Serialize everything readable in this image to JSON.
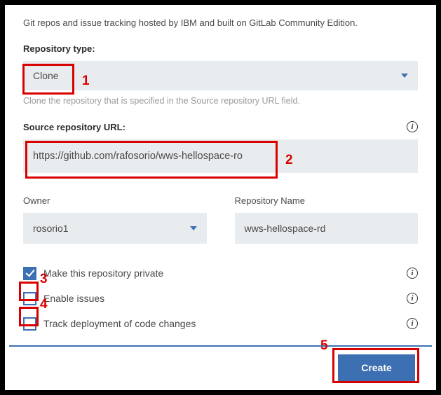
{
  "description": "Git repos and issue tracking hosted by IBM and built on GitLab Community Edition.",
  "repoType": {
    "label": "Repository type:",
    "value": "Clone",
    "helper": "Clone the repository that is specified in the Source repository URL field."
  },
  "sourceUrl": {
    "label": "Source repository URL:",
    "value": "https://github.com/rafosorio/wws-hellospace-ro"
  },
  "owner": {
    "label": "Owner",
    "value": "rosorio1"
  },
  "repoName": {
    "label": "Repository Name",
    "value": "wws-hellospace-rd"
  },
  "checkboxes": {
    "private": {
      "label": "Make this repository private",
      "checked": true
    },
    "issues": {
      "label": "Enable issues",
      "checked": false
    },
    "trackDeploy": {
      "label": "Track deployment of code changes",
      "checked": false
    }
  },
  "createButton": "Create",
  "annotations": {
    "a1": "1",
    "a2": "2",
    "a3": "3",
    "a4": "4",
    "a5": "5"
  }
}
